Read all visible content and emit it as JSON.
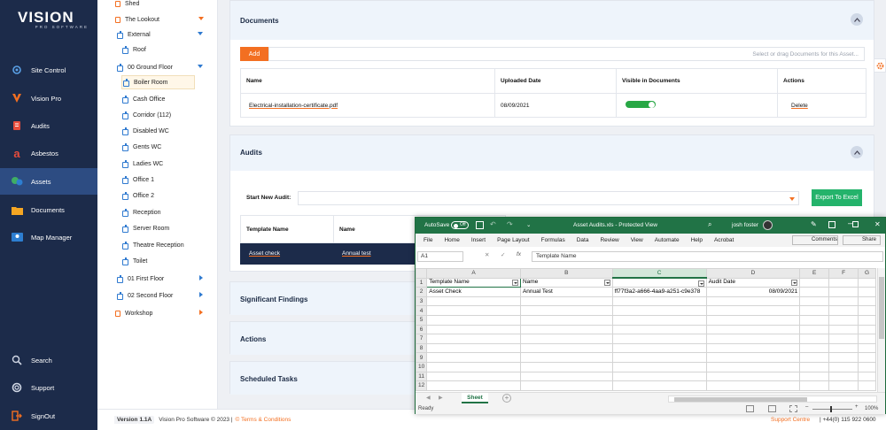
{
  "brand": {
    "name": "VISION",
    "tagline": "PRO SOFTWARE"
  },
  "nav": [
    {
      "label": "Site Control",
      "icon": "rocket-icon"
    },
    {
      "label": "Vision Pro",
      "icon": "v-logo-icon"
    },
    {
      "label": "Audits",
      "icon": "clipboard-icon"
    },
    {
      "label": "Asbestos",
      "icon": "asbestos-icon"
    },
    {
      "label": "Assets",
      "icon": "assets-icon",
      "active": true
    },
    {
      "label": "Documents",
      "icon": "folder-icon"
    },
    {
      "label": "Map Manager",
      "icon": "map-icon"
    },
    {
      "label": "Search",
      "icon": "search-icon"
    },
    {
      "label": "Support",
      "icon": "support-icon"
    },
    {
      "label": "SignOut",
      "icon": "signout-icon"
    }
  ],
  "tree": {
    "shed": "Shed",
    "lookout": "The Lookout",
    "external": "External",
    "roof": "Roof",
    "ground": "00 Ground Floor",
    "rooms": [
      "Boiler Room",
      "Cash Office",
      "Corridor (112)",
      "Disabled WC",
      "Gents WC",
      "Ladies WC",
      "Office 1",
      "Office 2",
      "Reception",
      "Server Room",
      "Theatre Reception",
      "Toilet"
    ],
    "first": "01 First Floor",
    "second": "02 Second Floor",
    "workshop": "Workshop"
  },
  "documents": {
    "title": "Documents",
    "add_label": "Add",
    "drop_placeholder": "Select or drag Documents for this Asset...",
    "columns": [
      "Name",
      "Uploaded Date",
      "Visible in Documents",
      "Actions"
    ],
    "row": {
      "name": "Electrical-installation-certificate.pdf",
      "date": "08/09/2021",
      "action": "Delete"
    }
  },
  "audits": {
    "title": "Audits",
    "start_label": "Start New Audit:",
    "export_label": "Export To Excel",
    "columns": [
      "Template Name",
      "Name"
    ],
    "row": {
      "template": "Asset check",
      "name": "Annual test"
    }
  },
  "sections": {
    "findings": "Significant Findings",
    "actions": "Actions",
    "tasks": "Scheduled Tasks"
  },
  "footer": {
    "version_label": "Version",
    "version": "1.1A",
    "copyright": "Vision Pro Software © 2023 |",
    "terms": "© Terms & Conditions",
    "support": "Support Centre",
    "phone": "| +44(0) 115 922 0600"
  },
  "excel": {
    "autosave": "AutoSave",
    "autosave_state": "Off",
    "title": "Asset Audits.xls  -  Protected View",
    "user": "josh foster",
    "menu": [
      "File",
      "Home",
      "Insert",
      "Page Layout",
      "Formulas",
      "Data",
      "Review",
      "View",
      "Automate",
      "Help",
      "Acrobat"
    ],
    "comments": "Comments",
    "share": "Share",
    "cell_ref": "A1",
    "formula": "Template Name",
    "col_headers": [
      "A",
      "B",
      "C",
      "D",
      "E",
      "F",
      "G"
    ],
    "rows": [
      [
        "Template Name",
        "Name",
        "",
        "Audit Date"
      ],
      [
        "Asset Check",
        "Annual Test",
        "ff77f3a2-a666-4aa9-a251-c9e378",
        "08/09/2021"
      ]
    ],
    "row_numbers": [
      "1",
      "2",
      "3",
      "4",
      "5",
      "6",
      "7",
      "8",
      "9",
      "10",
      "11",
      "12"
    ],
    "sheet": "Sheet",
    "status": "Ready",
    "zoom": "100%"
  }
}
